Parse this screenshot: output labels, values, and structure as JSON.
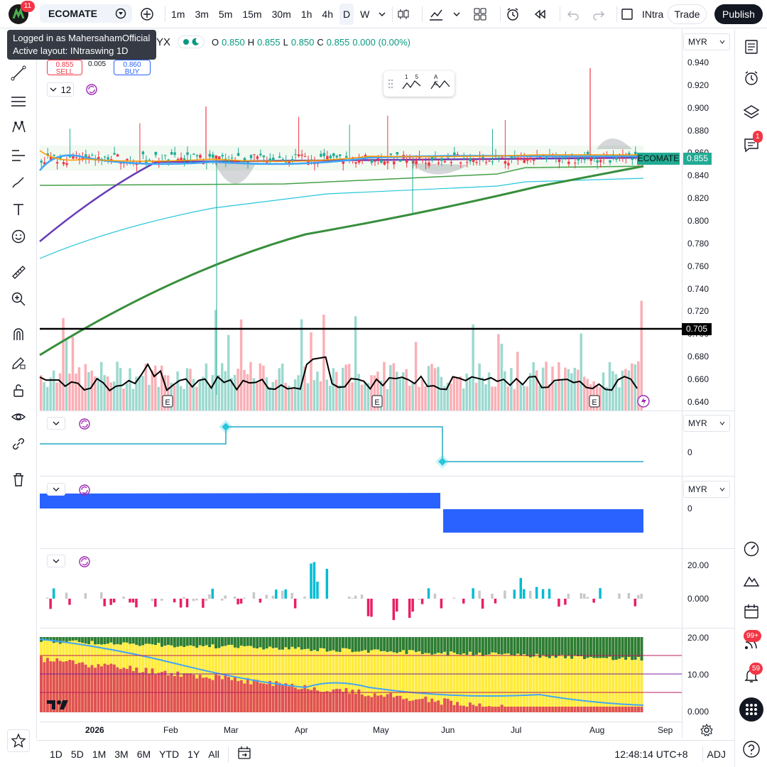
{
  "topbar": {
    "notification_count": "11",
    "symbol": "ECOMATE",
    "intervals": [
      "1m",
      "3m",
      "5m",
      "15m",
      "30m",
      "1h",
      "4h",
      "D",
      "W"
    ],
    "active_interval": "D",
    "layout_name": "INtra",
    "trade_label": "Trade",
    "publish_label": "Publish"
  },
  "tooltip": {
    "line1": "Logged in as MahersahamOfficial",
    "line2": "Active layout: INtraswing 1D"
  },
  "legend": {
    "exchange_fragment": "YX",
    "o_label": "O",
    "o_value": "0.850",
    "h_label": "H",
    "h_value": "0.855",
    "l_label": "L",
    "l_value": "0.850",
    "c_label": "C",
    "c_value": "0.855",
    "change": "0.000 (0.00%)"
  },
  "trading": {
    "sell_price": "0.855",
    "sell_label": "SELL",
    "spread": "0.005",
    "buy_price": "0.860",
    "buy_label": "BUY"
  },
  "indicator_input": "12",
  "price_axis": {
    "currency": "MYR",
    "labels": [
      "0.940",
      "0.920",
      "0.900",
      "0.880",
      "0.860",
      "0.840",
      "0.820",
      "0.800",
      "0.780",
      "0.760",
      "0.740",
      "0.720",
      "0.700",
      "0.680",
      "0.660",
      "0.640"
    ],
    "current_price": "0.855",
    "symbol_tag": "ECOMATE",
    "hline_price": "0.705"
  },
  "pane2": {
    "currency": "MYR",
    "zero": "0"
  },
  "pane3": {
    "currency": "MYR",
    "zero": "0"
  },
  "pane4": {
    "labels": [
      "20.00",
      "0.000"
    ]
  },
  "pane5": {
    "labels": [
      "20.00",
      "10.00",
      "0.000"
    ]
  },
  "time_axis": [
    "2026",
    "Feb",
    "Mar",
    "Apr",
    "May",
    "Jun",
    "Jul",
    "Aug",
    "Sep"
  ],
  "bottom": {
    "ranges": [
      "1D",
      "5D",
      "1M",
      "3M",
      "6M",
      "YTD",
      "1Y",
      "All"
    ],
    "clock": "12:48:14 UTC+8",
    "adj": "ADJ"
  },
  "right_badges": {
    "chat": "1",
    "alerts_feed": "99+",
    "notifications": "59"
  },
  "float_toolbar": {
    "a": "1 5",
    "b": "A C"
  },
  "earnings_marker": "E",
  "colors": {
    "up": "#22ab94",
    "down": "#f23645",
    "accent": "#2962ff",
    "ma_long": "#388e3c",
    "ma_purple": "#673ab7",
    "cyan": "#26c6da",
    "hist_blue": "#00bcd4",
    "hist_red": "#e91e63"
  },
  "chart_data": {
    "type": "line",
    "symbol": "ECOMATE",
    "ylim": [
      0.64,
      0.94
    ],
    "x": [
      "2026",
      "Feb",
      "Mar",
      "Apr",
      "May",
      "Jun",
      "Jul",
      "Aug",
      "Sep"
    ],
    "series": [
      {
        "values": [
          0.85,
          0.855,
          0.85,
          0.855,
          0.85,
          0.855,
          0.85,
          0.855,
          0.855
        ]
      }
    ]
  }
}
